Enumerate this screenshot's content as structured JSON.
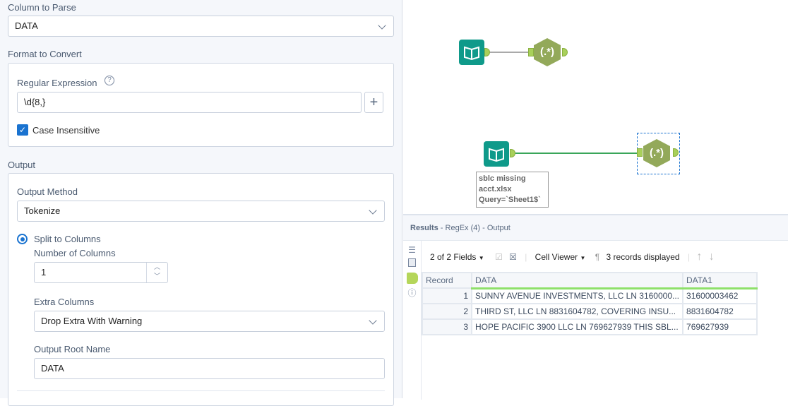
{
  "config": {
    "column_to_parse_label": "Column to Parse",
    "column_to_parse_value": "DATA",
    "format_label": "Format to Convert",
    "regex_label": "Regular Expression",
    "regex_value": "\\d{8,}",
    "add_label": "+",
    "case_insensitive_label": "Case Insensitive",
    "case_insensitive_checked": true,
    "output_label": "Output",
    "output_method_label": "Output Method",
    "output_method_value": "Tokenize",
    "split_label": "Split to Columns",
    "num_columns_label": "Number of Columns",
    "num_columns_value": "1",
    "extra_columns_label": "Extra Columns",
    "extra_columns_value": "Drop Extra With Warning",
    "root_name_label": "Output Root Name",
    "root_name_value": "DATA"
  },
  "canvas": {
    "annotation": [
      "sblc missing",
      "acct.xlsx",
      "Query=`Sheet1$`"
    ],
    "regex_glyph": "(.*)"
  },
  "results": {
    "title": "Results",
    "subtitle": " - RegEx (4) - Output",
    "fields": "2 of 2 Fields",
    "cell_viewer": "Cell Viewer",
    "records": "3 records displayed",
    "columns": [
      "Record",
      "DATA",
      "DATA1"
    ],
    "rows": [
      [
        "1",
        "SUNNY AVENUE INVESTMENTS, LLC  LN 3160000...",
        "31600003462"
      ],
      [
        "2",
        "THIRD ST, LLC  LN 8831604782, COVERING INSU...",
        "8831604782"
      ],
      [
        "3",
        "HOPE PACIFIC 3900 LLC  LN 769627939  THIS SBL...",
        "769627939"
      ]
    ]
  }
}
